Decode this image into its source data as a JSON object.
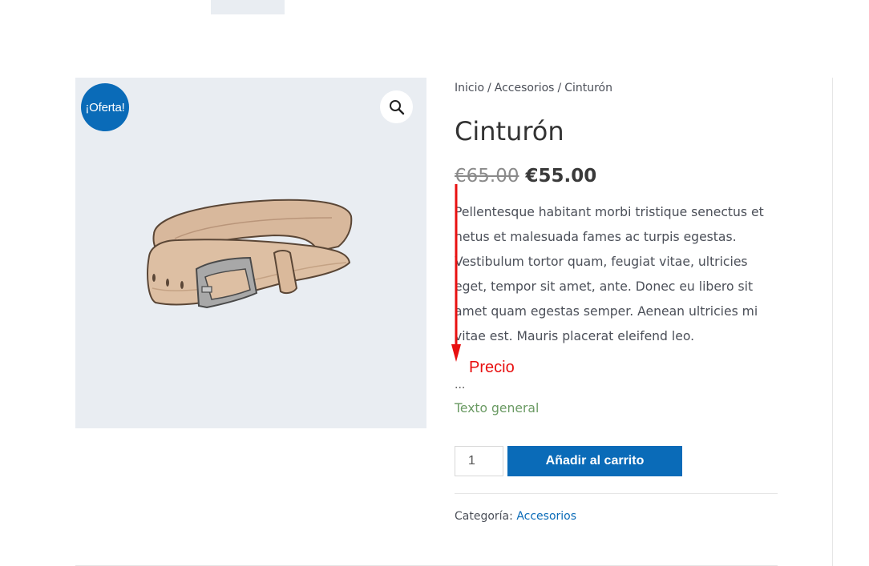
{
  "gallery": {
    "sale_badge": "¡Oferta!",
    "zoom_icon": "magnifier-icon",
    "image_subject": "belt"
  },
  "product": {
    "breadcrumb": [
      "Inicio",
      "Accesorios",
      "Cinturón"
    ],
    "breadcrumb_separator": "/",
    "title": "Cinturón",
    "price_old": "€65.00",
    "price_new": "€55.00",
    "description": "Pellentesque habitant morbi tristique senectus et netus et malesuada fames ac turpis egestas. Vestibulum tortor quam, feugiat vitae, ultricies eget, tempor sit amet, ante. Donec eu libero sit amet quam egestas semper. Aenean ultricies mi vitae est. Mauris placerat eleifend leo.",
    "ellipsis": "...",
    "general_text": "Texto general",
    "quantity": "1",
    "add_to_cart_label": "Añadir al carrito",
    "category_label": "Categoría:",
    "category_value": "Accesorios"
  },
  "annotation": {
    "label": "Precio",
    "color": "#e81010"
  },
  "colors": {
    "accent": "#0a6bb8",
    "gallery_bg": "#e9edf2",
    "general_text": "#6a9a63"
  }
}
